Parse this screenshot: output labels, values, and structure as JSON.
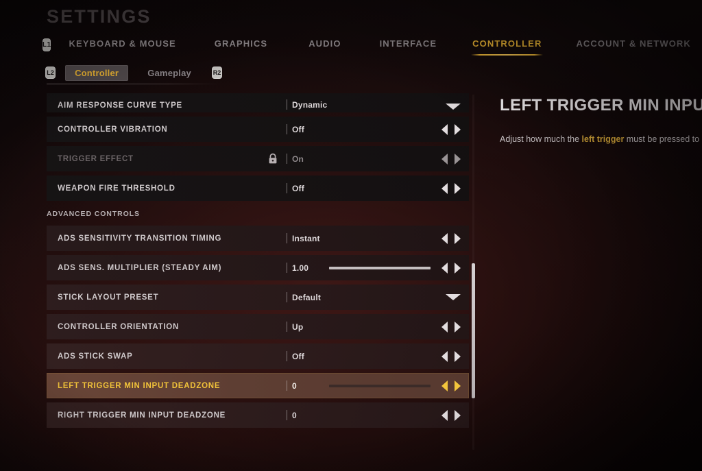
{
  "header": {
    "title": "SETTINGS",
    "left_bumper": "L1",
    "right_bumper": "R1",
    "tabs": [
      {
        "label": "KEYBOARD & MOUSE",
        "active": false
      },
      {
        "label": "GRAPHICS",
        "active": false
      },
      {
        "label": "AUDIO",
        "active": false
      },
      {
        "label": "INTERFACE",
        "active": false
      },
      {
        "label": "CONTROLLER",
        "active": true
      },
      {
        "label": "ACCOUNT & NETWORK",
        "active": false
      }
    ],
    "accent_color": "#e8b233"
  },
  "subtabs": {
    "left_trigger_badge": "L2",
    "right_trigger_badge": "R2",
    "items": [
      {
        "label": "Controller",
        "active": true
      },
      {
        "label": "Gameplay",
        "active": false
      }
    ]
  },
  "settings": {
    "rows": [
      {
        "label": "AIM RESPONSE CURVE TYPE",
        "value": "Dynamic",
        "control": "dropdown",
        "locked": false,
        "selected": false,
        "clipped": true
      },
      {
        "label": "CONTROLLER VIBRATION",
        "value": "Off",
        "control": "arrows",
        "locked": false,
        "selected": false
      },
      {
        "label": "TRIGGER EFFECT",
        "value": "On",
        "control": "arrows",
        "locked": true,
        "lock_icon": "lock-icon",
        "selected": false
      },
      {
        "label": "WEAPON FIRE THRESHOLD",
        "value": "Off",
        "control": "arrows",
        "locked": false,
        "selected": false
      }
    ],
    "section_header": "ADVANCED CONTROLS",
    "advanced_rows": [
      {
        "label": "ADS SENSITIVITY TRANSITION TIMING",
        "value": "Instant",
        "control": "arrows",
        "selected": false
      },
      {
        "label": "ADS SENS. MULTIPLIER (STEADY AIM)",
        "value": "1.00",
        "control": "slider",
        "slider_fill": 100,
        "selected": false
      },
      {
        "label": "STICK LAYOUT PRESET",
        "value": "Default",
        "control": "dropdown",
        "selected": false
      },
      {
        "label": "CONTROLLER ORIENTATION",
        "value": "Up",
        "control": "arrows",
        "selected": false
      },
      {
        "label": "ADS STICK SWAP",
        "value": "Off",
        "control": "arrows",
        "selected": false
      },
      {
        "label": "LEFT TRIGGER MIN INPUT DEADZONE",
        "value": "0",
        "control": "slider",
        "slider_fill": 0,
        "selected": true
      },
      {
        "label": "RIGHT TRIGGER MIN INPUT DEADZONE",
        "value": "0",
        "control": "arrows",
        "selected": false
      }
    ]
  },
  "detail": {
    "title": "LEFT TRIGGER MIN INPUT",
    "description_before": "Adjust how much the ",
    "description_highlight": "left trigger",
    "description_after": " must be pressed to"
  }
}
